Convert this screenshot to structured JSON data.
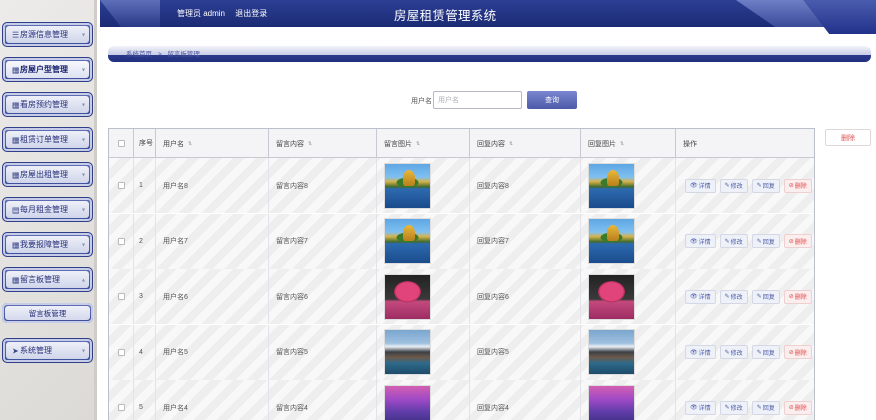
{
  "header": {
    "user_label": "管理员 admin",
    "logout_label": "退出登录",
    "site_title": "房屋租赁管理系统"
  },
  "sidebar": {
    "items": [
      {
        "label": "房源信息管理",
        "icon": "sliders-icon"
      },
      {
        "label": "房屋户型管理",
        "icon": "grid-icon"
      },
      {
        "label": "看房预约管理",
        "icon": "grid-icon"
      },
      {
        "label": "租赁订单管理",
        "icon": "grid-icon"
      },
      {
        "label": "房屋出租管理",
        "icon": "grid-icon"
      },
      {
        "label": "每月租金管理",
        "icon": "list-icon"
      },
      {
        "label": "我要报障管理",
        "icon": "grid-icon"
      },
      {
        "label": "留言板管理",
        "icon": "grid-icon"
      },
      {
        "label": "系统管理",
        "icon": "send-icon"
      }
    ],
    "submenu_label": "留言板管理"
  },
  "breadcrumb": {
    "home": "系统首页",
    "separator": ">",
    "current": "留言板管理"
  },
  "search": {
    "label": "用户名",
    "placeholder": "用户名",
    "button_label": "查询"
  },
  "batch_delete_label": "删除",
  "table": {
    "columns": [
      "序号",
      "用户名",
      "留言内容",
      "留言图片",
      "回复内容",
      "回复图片",
      "操作"
    ],
    "actions": {
      "detail": "详情",
      "edit": "修改",
      "reply": "回复",
      "delete": "删除"
    },
    "rows": [
      {
        "index": "1",
        "username": "用户名8",
        "content": "留言内容8",
        "reply": "回复内容8",
        "image": "scene-lake"
      },
      {
        "index": "2",
        "username": "用户名7",
        "content": "留言内容7",
        "reply": "回复内容7",
        "image": "scene-lake"
      },
      {
        "index": "3",
        "username": "用户名6",
        "content": "留言内容6",
        "reply": "回复内容6",
        "image": "scene-pink"
      },
      {
        "index": "4",
        "username": "用户名5",
        "content": "留言内容5",
        "reply": "回复内容5",
        "image": "scene-mount"
      },
      {
        "index": "5",
        "username": "用户名4",
        "content": "留言内容4",
        "reply": "回复内容4",
        "image": "scene-purple"
      }
    ]
  },
  "colors": {
    "header_blue": "#1b2a74",
    "menu_blue": "#3c4d9b",
    "danger_red": "#e05252"
  }
}
